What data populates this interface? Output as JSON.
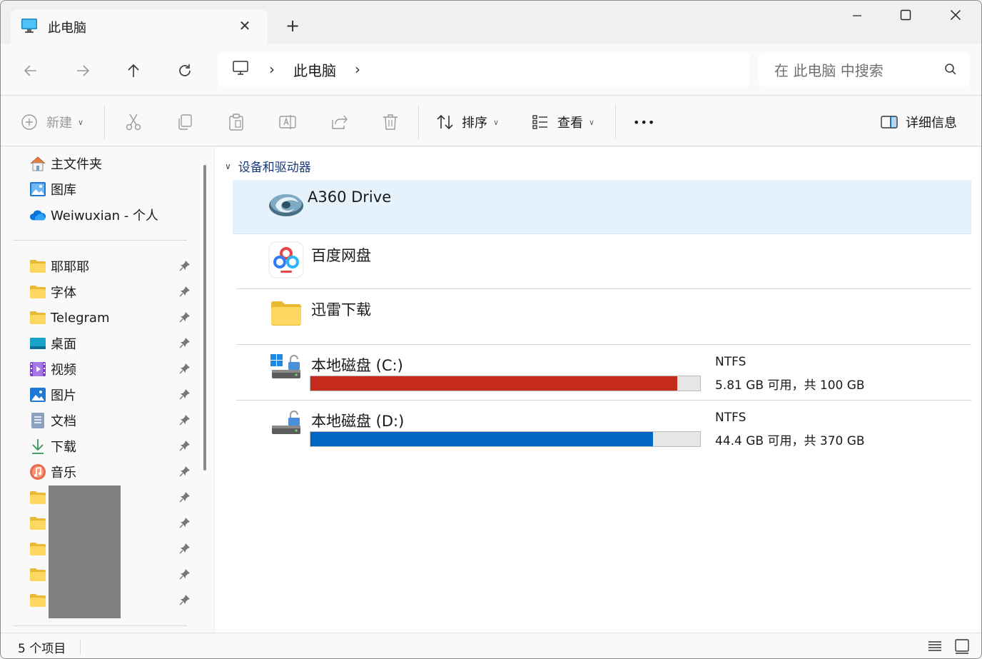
{
  "tab": {
    "title": "此电脑"
  },
  "address": {
    "crumbs": [
      "此电脑"
    ]
  },
  "search": {
    "placeholder": "在 此电脑 中搜索"
  },
  "toolbar": {
    "new_label": "新建",
    "sort_label": "排序",
    "view_label": "查看",
    "more_label": "•••",
    "details_label": "详细信息"
  },
  "sidebar": {
    "top": [
      {
        "label": "主文件夹",
        "icon": "home-icon"
      },
      {
        "label": "图库",
        "icon": "gallery-icon"
      },
      {
        "label": "Weiwuxian - 个人",
        "icon": "onedrive-cloud-icon"
      }
    ],
    "pinned": [
      {
        "label": "耶耶耶",
        "icon": "folder-icon"
      },
      {
        "label": "字体",
        "icon": "folder-icon"
      },
      {
        "label": "Telegram",
        "icon": "folder-icon"
      },
      {
        "label": "桌面",
        "icon": "desktop-icon"
      },
      {
        "label": "视频",
        "icon": "videos-icon"
      },
      {
        "label": "图片",
        "icon": "pictures-icon"
      },
      {
        "label": "文档",
        "icon": "documents-icon"
      },
      {
        "label": "下载",
        "icon": "download-icon"
      },
      {
        "label": "音乐",
        "icon": "music-icon"
      },
      {
        "label": "",
        "icon": "folder-icon"
      },
      {
        "label": "",
        "icon": "folder-icon"
      },
      {
        "label": "",
        "icon": "folder-icon"
      },
      {
        "label": "",
        "icon": "folder-icon"
      },
      {
        "label": "",
        "icon": "folder-icon"
      }
    ]
  },
  "main": {
    "group_label": "设备和驱动器",
    "items": [
      {
        "name": "A360 Drive",
        "icon": "a360-drive-icon"
      },
      {
        "name": "百度网盘",
        "icon": "baidu-netdisk-icon"
      },
      {
        "name": "迅雷下载",
        "icon": "folder-icon"
      }
    ],
    "drives": [
      {
        "name": "本地磁盘 (C:)",
        "fs": "NTFS",
        "space": "5.81 GB 可用，共 100 GB",
        "used_fraction": 0.942,
        "bar_color": "#c42b1c",
        "icon": "system-drive-icon"
      },
      {
        "name": "本地磁盘 (D:)",
        "fs": "NTFS",
        "space": "44.4 GB 可用，共 370 GB",
        "used_fraction": 0.88,
        "bar_color": "#0067c0",
        "icon": "local-drive-icon"
      }
    ]
  },
  "status": {
    "count_text": "5 个项目"
  },
  "colors": {
    "accent": "#0067c0",
    "danger": "#c42b1c",
    "selection": "#e5f1fb"
  }
}
